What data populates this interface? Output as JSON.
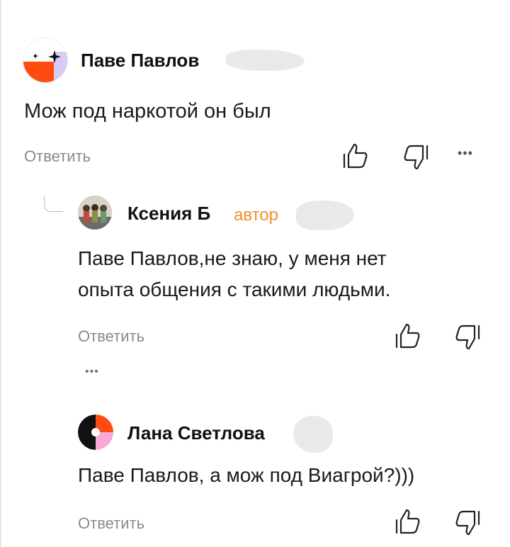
{
  "comments": [
    {
      "author": "Паве Павлов",
      "text": "Мож под наркотой он был",
      "reply_label": "Ответить",
      "more_label": "•••"
    },
    {
      "author": "Ксения Б",
      "badge": "автор",
      "text_lines": [
        "Паве Павлов,не знаю, у меня нет",
        "опыта общения с такими людьми."
      ],
      "reply_label": "Ответить"
    },
    {
      "collapsed_label": "•••"
    },
    {
      "author": "Лана Светлова",
      "text": "Паве Павлов, а мож под Виагрой?)))",
      "reply_label": "Ответить"
    }
  ],
  "colors": {
    "accent_orange": "#f0902a",
    "avatar_red": "#ff4b12",
    "avatar_lavender": "#d9cbf5",
    "avatar_pink": "#f7a9d6",
    "muted_text": "#8a8a8a"
  },
  "icons": [
    "sparkle-icon",
    "thumbs-up-icon",
    "thumbs-down-icon",
    "more-icon"
  ]
}
